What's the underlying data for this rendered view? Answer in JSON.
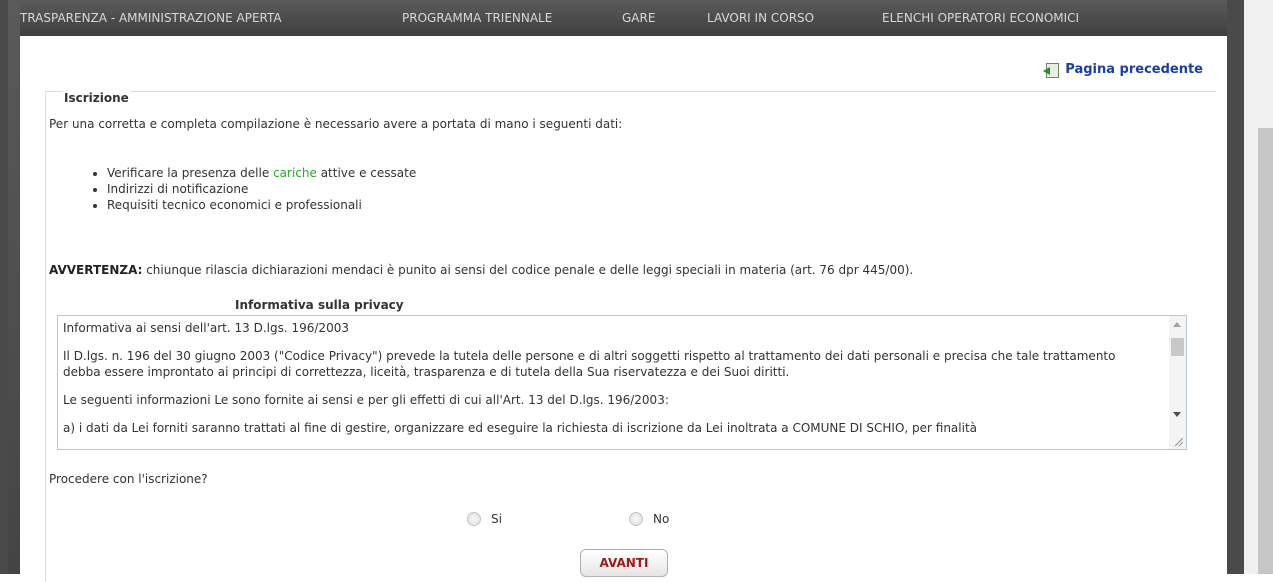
{
  "nav": {
    "items": [
      "TRASPARENZA - AMMINISTRAZIONE APERTA",
      "PROGRAMMA TRIENNALE",
      "GARE",
      "LAVORI IN CORSO",
      "ELENCHI OPERATORI ECONOMICI"
    ]
  },
  "back_link": {
    "label": "Pagina precedente",
    "icon": "back-page-icon"
  },
  "section": {
    "legend": "Iscrizione",
    "intro": "Per una corretta e completa compilazione è necessario avere a portata di mano i seguenti dati:",
    "requirements": [
      {
        "before": "Verificare la presenza delle ",
        "link": "cariche",
        "after": " attive e cessate"
      },
      {
        "before": "Indirizzi di notificazione",
        "link": "",
        "after": ""
      },
      {
        "before": "Requisiti tecnico economici e professionali",
        "link": "",
        "after": ""
      }
    ],
    "warning_label": "AVVERTENZA:",
    "warning_text": " chiunque rilascia dichiarazioni mendaci è punito ai sensi del codice penale e delle leggi speciali in materia (art. 76 dpr 445/00)."
  },
  "privacy": {
    "title": "Informativa sulla privacy",
    "paragraphs": [
      "Informativa ai sensi dell'art. 13 D.lgs. 196/2003",
      "Il D.lgs. n. 196 del 30 giugno 2003 (\"Codice Privacy\") prevede la tutela delle persone e di altri soggetti rispetto al trattamento dei dati personali e precisa che tale trattamento debba essere improntato ai principi di correttezza, liceità, trasparenza e di tutela della Sua riservatezza e dei Suoi diritti.",
      "Le seguenti informazioni Le sono fornite ai sensi e per gli effetti di cui all'Art. 13 del D.lgs. 196/2003:",
      "a) i dati da Lei forniti saranno trattati al fine di gestire, organizzare ed eseguire la richiesta di iscrizione da Lei inoltrata a COMUNE DI SCHIO, per finalità"
    ]
  },
  "form": {
    "question": "Procedere con l'iscrizione?",
    "options": [
      "Si",
      "No"
    ],
    "submit_label": "AVANTI"
  },
  "colors": {
    "nav_bg": "#4a4a4a",
    "link_blue": "#1a3ea8",
    "link_green": "#2aa52a",
    "button_text": "#a01818"
  }
}
